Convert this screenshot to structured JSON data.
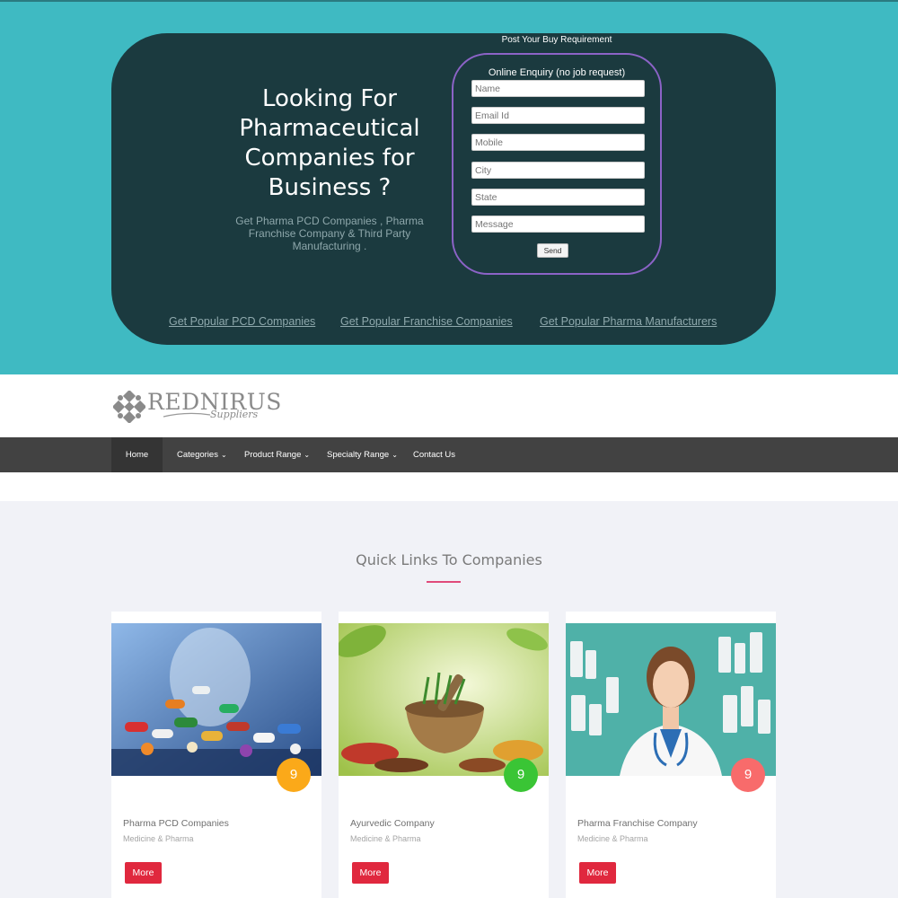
{
  "hero": {
    "title": "Looking For Pharmaceutical Companies for Business ?",
    "subtitle": "Get Pharma PCD Companies , Pharma Franchise Company & Third Party Manufacturing .",
    "buy_requirement": "Post Your Buy Requirement",
    "form": {
      "title": "Online Enquiry (no job request)",
      "fields": [
        {
          "placeholder": "Name"
        },
        {
          "placeholder": "Email Id"
        },
        {
          "placeholder": "Mobile"
        },
        {
          "placeholder": "City"
        },
        {
          "placeholder": "State"
        },
        {
          "placeholder": "Message"
        }
      ],
      "send_label": "Send"
    },
    "links": [
      {
        "label": "Get Popular PCD Companies"
      },
      {
        "label": "Get Popular Franchise Companies"
      },
      {
        "label": "Get Popular Pharma Manufacturers"
      }
    ]
  },
  "logo": {
    "name": "REDNIRUS",
    "tagline": "Suppliers"
  },
  "nav": {
    "items": [
      {
        "label": "Home"
      },
      {
        "label": "Categories"
      },
      {
        "label": "Product Range"
      },
      {
        "label": "Specialty Range"
      },
      {
        "label": "Contact Us"
      }
    ]
  },
  "section": {
    "title": "Quick Links To Companies"
  },
  "cards": [
    {
      "name": "Pharma PCD Companies",
      "category": "Medicine & Pharma",
      "count": "9",
      "badge_color": "#fba919",
      "button": "More",
      "image": "pills-image"
    },
    {
      "name": "Ayurvedic Company",
      "category": "Medicine & Pharma",
      "count": "9",
      "badge_color": "#3ac535",
      "button": "More",
      "image": "herbs-mortar-image"
    },
    {
      "name": "Pharma Franchise Company",
      "category": "Medicine & Pharma",
      "count": "9",
      "badge_color": "#f86b6b",
      "button": "More",
      "image": "doctor-image"
    }
  ],
  "colors": {
    "hero_bg": "#3fbac2",
    "hero_card": "#1b3a3f",
    "form_border": "#8c63c7",
    "navbar": "#424242",
    "accent_rule": "#e04a7a",
    "button": "#e0283e"
  }
}
